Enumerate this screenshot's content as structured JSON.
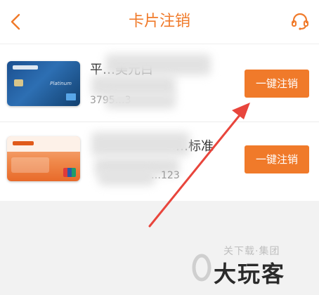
{
  "header": {
    "title": "卡片注销",
    "back_icon": "chevron-left-icon",
    "service_icon": "headset-icon"
  },
  "cards": [
    {
      "name": "平…美元白",
      "number": "3795…3",
      "button_label": "一键注销",
      "card_style": "blue-platinum"
    },
    {
      "name": "…标准",
      "number": "…123",
      "button_label": "一键注销",
      "card_style": "orange-pingan"
    }
  ],
  "watermark": {
    "sub": "关下载·集团",
    "main": "大玩客"
  },
  "colors": {
    "accent": "#f07a2a",
    "background": "#f2f2f2",
    "arrow": "#e8453c"
  }
}
